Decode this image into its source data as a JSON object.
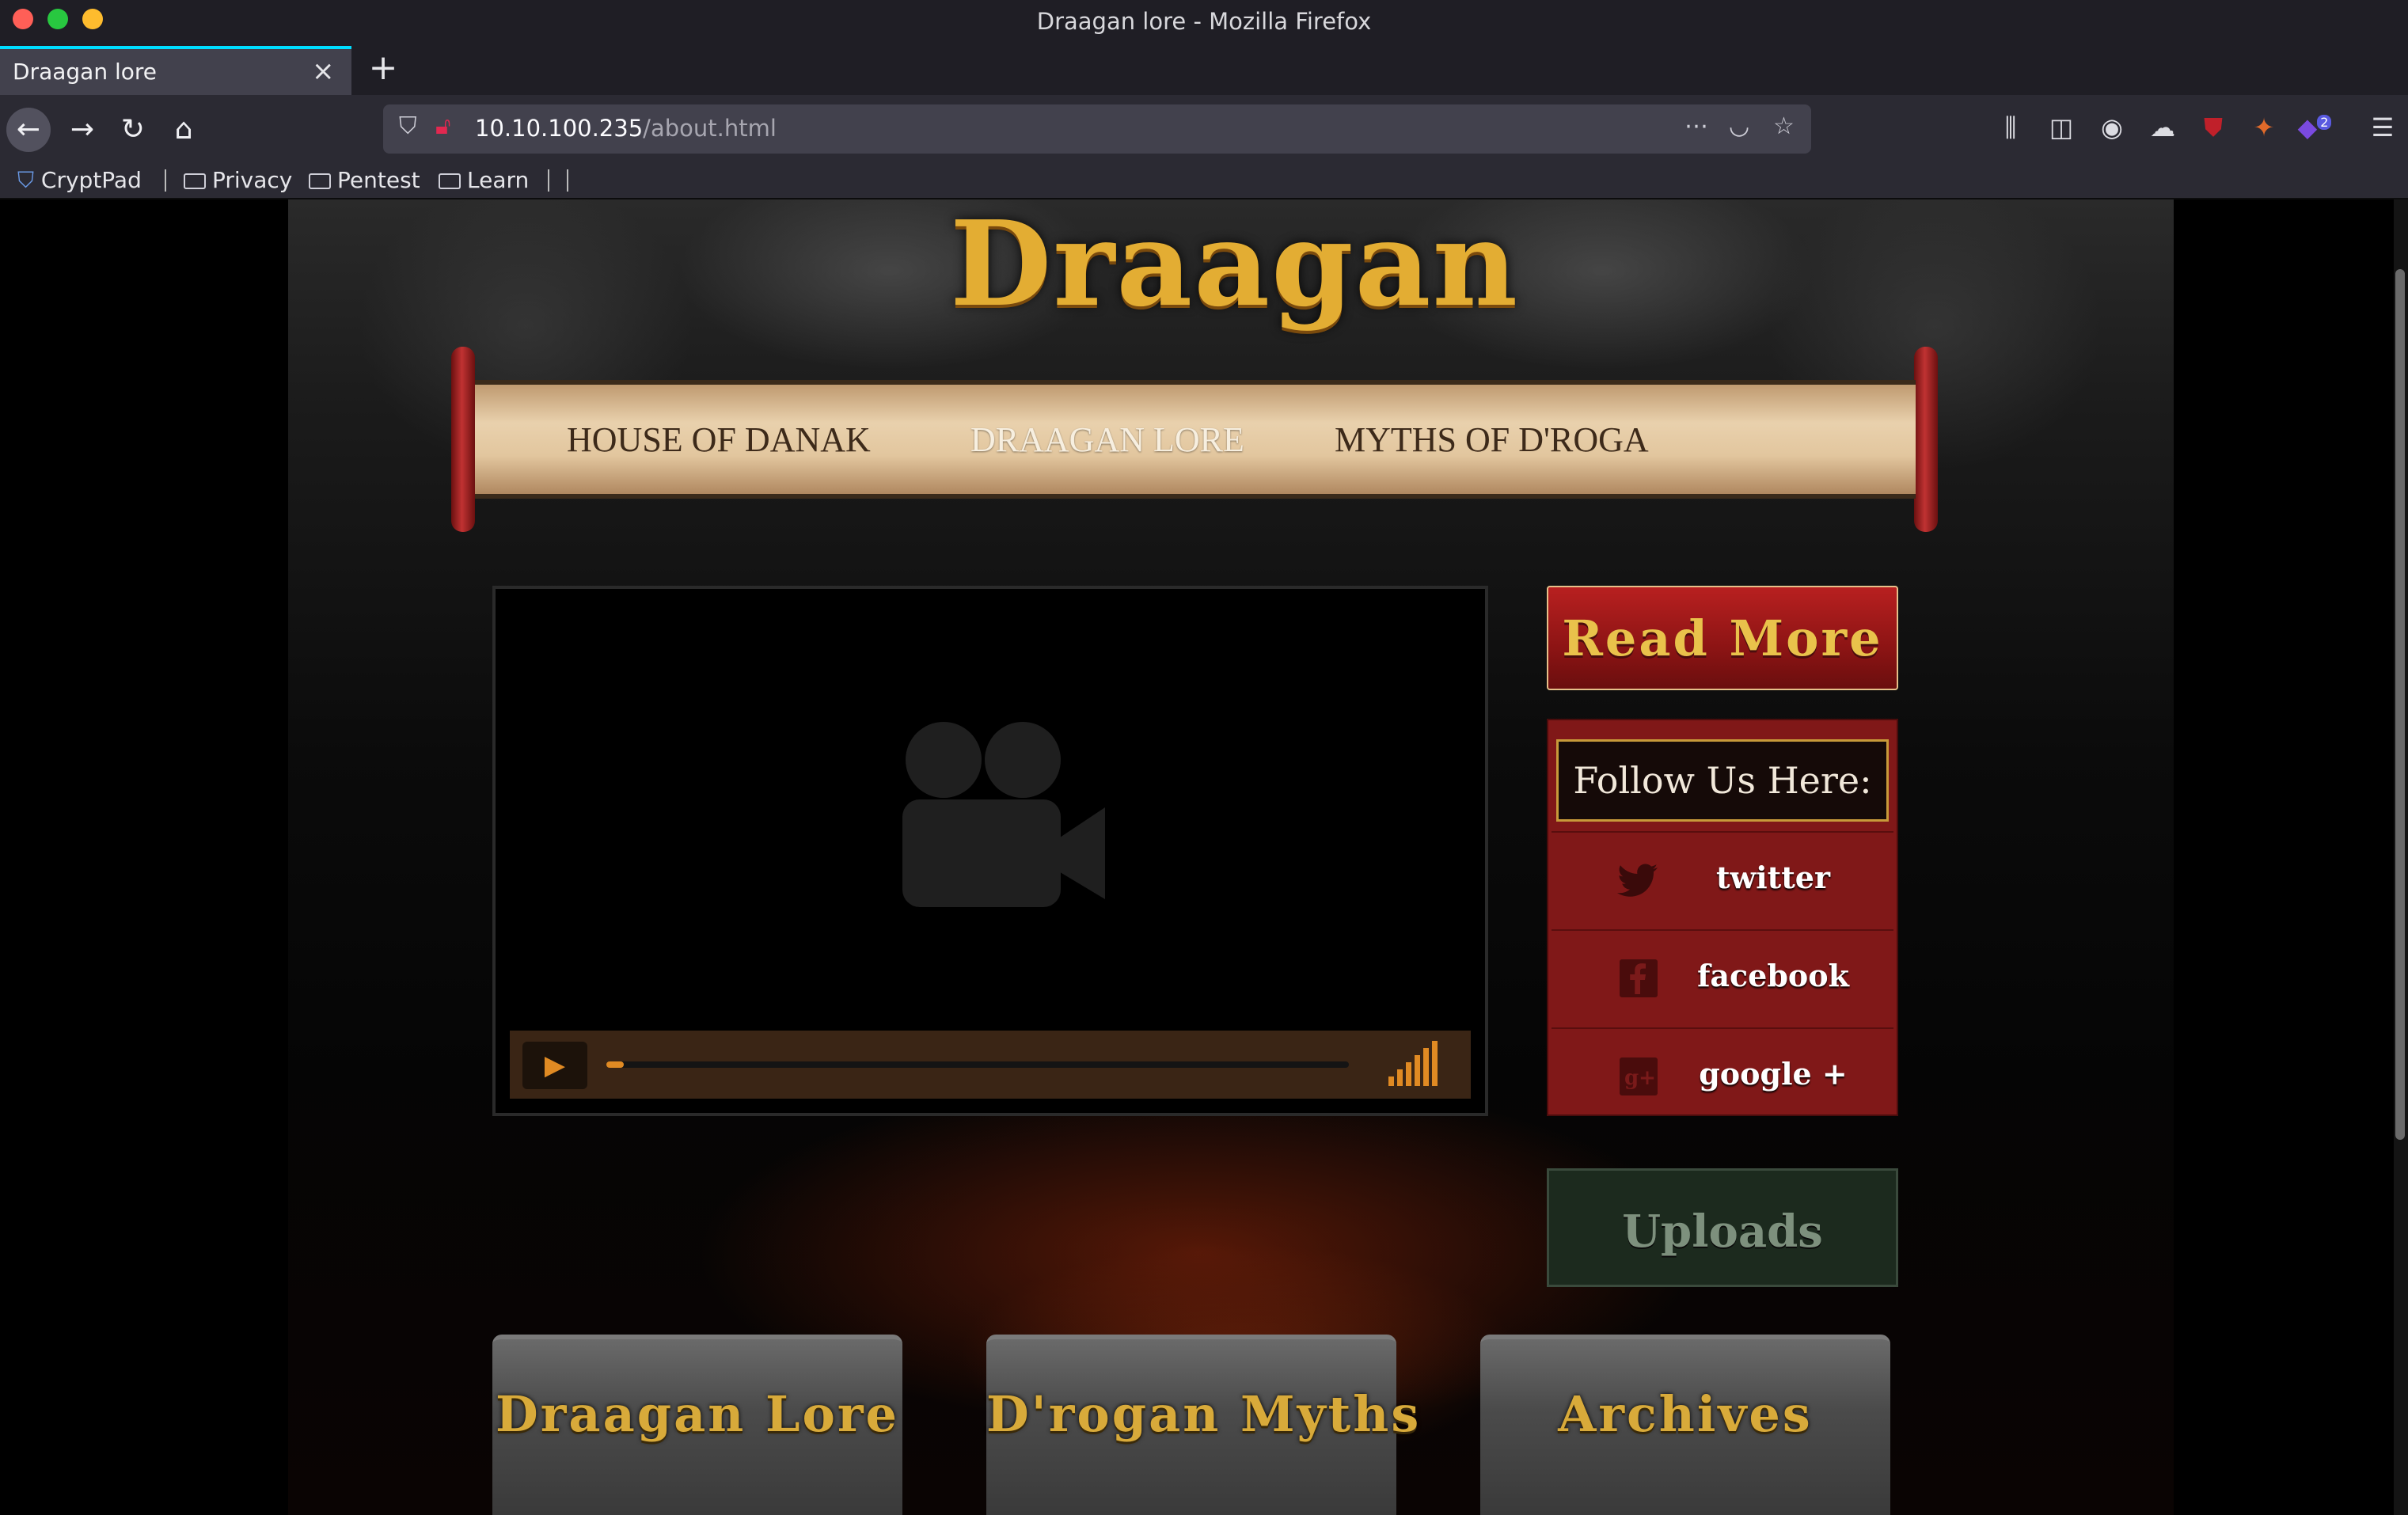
{
  "window": {
    "title": "Draagan lore - Mozilla Firefox"
  },
  "tab": {
    "title": "Draagan lore"
  },
  "urlbar": {
    "host": "10.10.100.235",
    "path": "/about.html"
  },
  "toolbar": {
    "extension_badge": "2"
  },
  "bookmarks": [
    {
      "label": "CryptPad",
      "icon": "cryptpad-shield-icon"
    },
    {
      "label": "Privacy",
      "icon": "folder-icon"
    },
    {
      "label": "Pentest",
      "icon": "folder-icon"
    },
    {
      "label": "Learn",
      "icon": "folder-icon"
    }
  ],
  "site": {
    "logo": "Draagan",
    "menu": [
      "HOUSE OF DANAK",
      "DRAAGAN LORE",
      "MYTHS OF D'ROGA"
    ],
    "active_menu": "DRAAGAN LORE",
    "video": {
      "progress": 0.015,
      "volume_bars": 6
    },
    "read_more": "Read More",
    "follow": {
      "title": "Follow Us Here:",
      "items": [
        {
          "label": "twitter",
          "icon": "twitter-bird-icon"
        },
        {
          "label": "facebook",
          "icon": "facebook-icon"
        },
        {
          "label": "google +",
          "icon": "google-plus-icon"
        }
      ]
    },
    "uploads": "Uploads",
    "tiles": [
      "Draagan Lore",
      "D'rogan Myths",
      "Archives"
    ]
  },
  "colors": {
    "accent_gold": "#e3ad33",
    "panel_red": "#801818",
    "tab_accent": "#00ddff"
  }
}
